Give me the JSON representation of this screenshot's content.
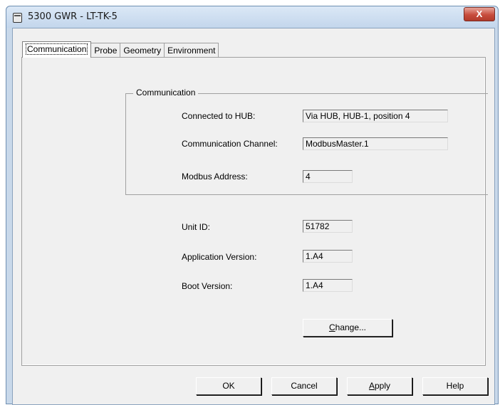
{
  "window": {
    "title": "5300 GWR  - LT-TK-5",
    "close_glyph": "X"
  },
  "tabs": [
    {
      "label": "Communication",
      "active": true
    },
    {
      "label": "Probe",
      "active": false
    },
    {
      "label": "Geometry",
      "active": false
    },
    {
      "label": "Environment",
      "active": false
    }
  ],
  "communication_group": {
    "title": "Communication",
    "connected_to_hub": {
      "label": "Connected to HUB:",
      "value": "Via HUB,  HUB-1, position 4"
    },
    "communication_channel": {
      "label": "Communication Channel:",
      "value": "ModbusMaster.1"
    },
    "modbus_address": {
      "label": "Modbus Address:",
      "value": "4"
    }
  },
  "device_info": {
    "unit_id": {
      "label": "Unit ID:",
      "value": "51782"
    },
    "application_version": {
      "label": "Application Version:",
      "value": "1.A4"
    },
    "boot_version": {
      "label": "Boot Version:",
      "value": "1.A4"
    }
  },
  "change_button": {
    "label_prefix": "C",
    "label_rest": "hange..."
  },
  "footer_buttons": {
    "ok": "OK",
    "cancel": "Cancel",
    "apply_prefix": "A",
    "apply_rest": "pply",
    "help": "Help"
  }
}
